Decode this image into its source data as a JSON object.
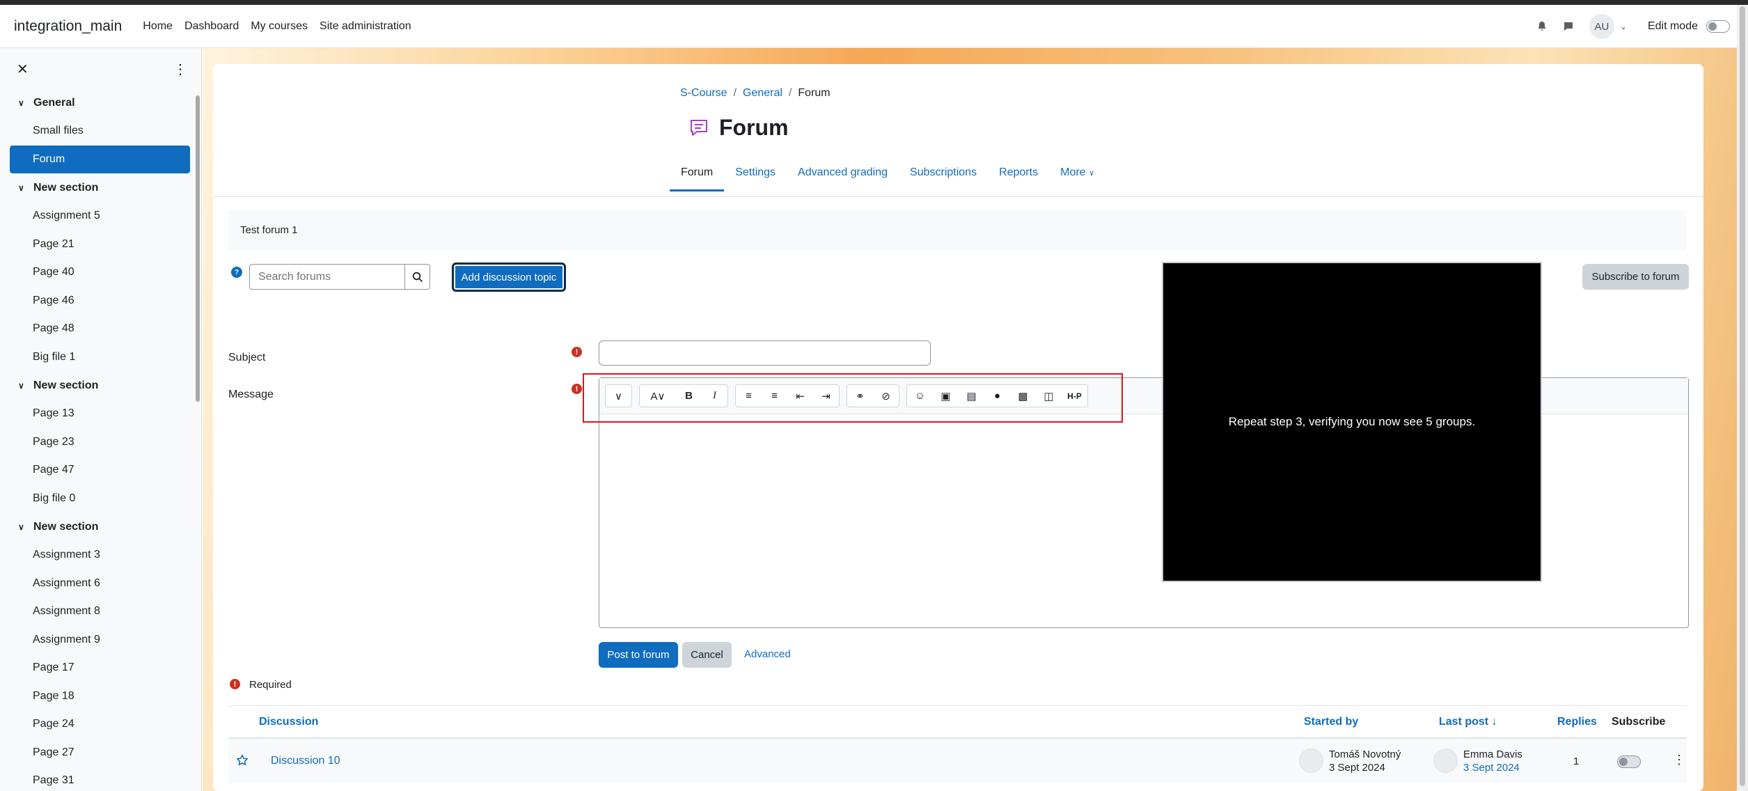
{
  "navbar": {
    "brand": "integration_main",
    "links": [
      "Home",
      "Dashboard",
      "My courses",
      "Site administration"
    ],
    "avatar_initials": "AU",
    "edit_mode_label": "Edit mode"
  },
  "drawer": {
    "sections": [
      {
        "title": "General",
        "items": [
          "Small files",
          "Forum"
        ]
      },
      {
        "title": "New section",
        "items": [
          "Assignment 5",
          "Page 21",
          "Page 40",
          "Page 46",
          "Page 48",
          "Big file 1"
        ]
      },
      {
        "title": "New section",
        "items": [
          "Page 13",
          "Page 23",
          "Page 47",
          "Big file 0"
        ]
      },
      {
        "title": "New section",
        "items": [
          "Assignment 3",
          "Assignment 6",
          "Assignment 8",
          "Assignment 9",
          "Page 17",
          "Page 18",
          "Page 24",
          "Page 27",
          "Page 31"
        ]
      }
    ],
    "active_item": "Forum"
  },
  "breadcrumb": [
    "S-Course",
    "General",
    "Forum"
  ],
  "page_title": "Forum",
  "tabs": [
    "Forum",
    "Settings",
    "Advanced grading",
    "Subscriptions",
    "Reports",
    "More"
  ],
  "intro_text": "Test forum 1",
  "search": {
    "placeholder": "Search forums"
  },
  "buttons": {
    "add_topic": "Add discussion topic",
    "subscribe": "Subscribe to forum",
    "post": "Post to forum",
    "cancel": "Cancel",
    "advanced": "Advanced"
  },
  "form": {
    "subject_label": "Subject",
    "message_label": "Message",
    "required_label": "Required"
  },
  "video_overlay_text": "Repeat step 3, verifying you now see 5 groups.",
  "table": {
    "headers": {
      "discussion": "Discussion",
      "started_by": "Started by",
      "last_post": "Last post",
      "replies": "Replies",
      "subscribe": "Subscribe"
    },
    "rows": [
      {
        "discussion": "Discussion 10",
        "started_name": "Tomáš Novotný",
        "started_date": "3 Sept 2024",
        "last_name": "Emma Davis",
        "last_date": "3 Sept 2024",
        "replies": "1"
      }
    ]
  },
  "colors": {
    "primary": "#0f6cbf",
    "required": "#ca3120",
    "highlight": "#e2131a"
  }
}
